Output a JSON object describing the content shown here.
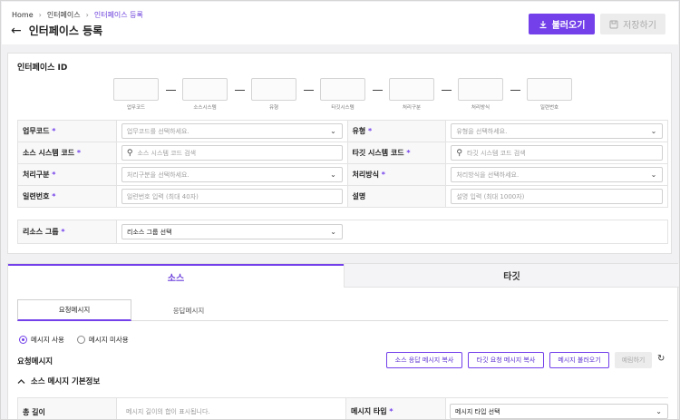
{
  "breadcrumb": [
    "Home",
    "인터페이스",
    "인터페이스 등록"
  ],
  "page_title": "인터페이스 등록",
  "buttons": {
    "load": "불러오기",
    "save": "저장하기"
  },
  "interface_id": {
    "title": "인터페이스 ID",
    "parts": [
      "업무코드",
      "소스시스템",
      "유형",
      "타깃시스템",
      "처리구분",
      "처리방식",
      "일련번호"
    ]
  },
  "form": {
    "rows": [
      [
        {
          "label": "업무코드",
          "required": "*",
          "placeholder": "업무코드를 선택하세요.",
          "kind": "select"
        },
        {
          "label": "유형",
          "required": "*",
          "placeholder": "유형을 선택하세요.",
          "kind": "select"
        }
      ],
      [
        {
          "label": "소스 시스템 코드",
          "required": "*",
          "placeholder": "소스 시스템 코드 검색",
          "kind": "search"
        },
        {
          "label": "타깃 시스템 코드",
          "required": "*",
          "placeholder": "타깃 시스템 코드 검색",
          "kind": "search"
        }
      ],
      [
        {
          "label": "처리구분",
          "required": "*",
          "placeholder": "처리구분을 선택하세요.",
          "kind": "select"
        },
        {
          "label": "처리방식",
          "required": "*",
          "placeholder": "처리방식을 선택하세요.",
          "kind": "select"
        }
      ],
      [
        {
          "label": "일련번호",
          "required": "*",
          "placeholder": "일련번호 입력 (최대 40자)",
          "kind": "text"
        },
        {
          "label": "설명",
          "required": "",
          "placeholder": "설명 입력 (최대 1000자)",
          "kind": "text"
        }
      ]
    ],
    "resource_group": {
      "label": "리소스 그룹",
      "required": "*",
      "value": "리소스 그룹 선택"
    }
  },
  "tabs": {
    "source": "소스",
    "target": "타깃"
  },
  "subtabs": {
    "request": "요청메시지",
    "response": "응답메시지"
  },
  "radios": {
    "use": "메시지 사용",
    "not_use": "메시지 미사용"
  },
  "request_section": {
    "title": "요청메시지",
    "btn_copy_source_response": "소스 응답 메시지 복사",
    "btn_copy_target_request": "타깃 요청 메시지 복사",
    "btn_load_message": "메시지 불러오기",
    "btn_preview": "예림하기"
  },
  "basic_info": {
    "title": "소스 메시지 기본정보",
    "total_length_label": "총 길이",
    "total_length_placeholder": "메시지 길이의 합이 표시됩니다.",
    "message_type_label": "메시지 타입",
    "message_type_required": "*",
    "message_type_value": "메시지 타입 선택"
  },
  "colors": {
    "accent": "#7340ea",
    "disabled_bg": "#ececec"
  },
  "icons": [
    "back-arrow-icon",
    "download-icon",
    "save-icon",
    "chevron-down-icon",
    "search-icon",
    "refresh-icon",
    "chevron-up-icon"
  ]
}
